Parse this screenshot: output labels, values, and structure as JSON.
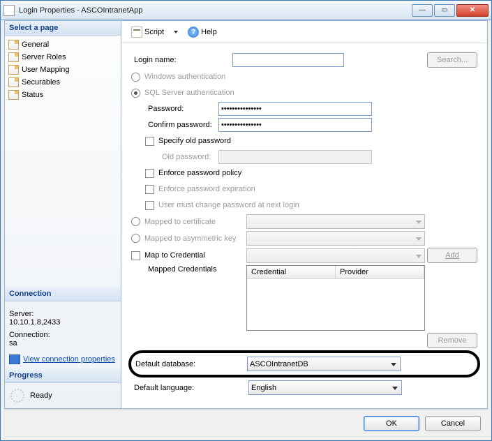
{
  "window": {
    "title": "Login Properties - ASCOIntranetApp"
  },
  "sidebar": {
    "select_page": "Select a page",
    "pages": [
      "General",
      "Server Roles",
      "User Mapping",
      "Securables",
      "Status"
    ],
    "connection_header": "Connection",
    "server_label": "Server:",
    "server_value": "10.10.1.8,2433",
    "connection_label": "Connection:",
    "connection_value": "sa",
    "view_props": "View connection properties",
    "progress_header": "Progress",
    "progress_status": "Ready"
  },
  "toolbar": {
    "script": "Script",
    "help": "Help"
  },
  "form": {
    "login_name_label": "Login name:",
    "login_name_value": "",
    "search_btn": "Search...",
    "windows_auth": "Windows authentication",
    "sql_auth": "SQL Server authentication",
    "password_label": "Password:",
    "password_value": "•••••••••••••••",
    "confirm_label": "Confirm password:",
    "confirm_value": "•••••••••••••••",
    "specify_old": "Specify old password",
    "old_password_label": "Old password:",
    "enforce_policy": "Enforce password policy",
    "enforce_expiration": "Enforce password expiration",
    "must_change": "User must change password at next login",
    "mapped_cert": "Mapped to certificate",
    "mapped_asym": "Mapped to asymmetric key",
    "map_credential": "Map to Credential",
    "add_btn": "Add",
    "mapped_credentials": "Mapped Credentials",
    "col_credential": "Credential",
    "col_provider": "Provider",
    "remove_btn": "Remove",
    "default_db_label": "Default database:",
    "default_db_value": "ASCOIntranetDB",
    "default_lang_label": "Default language:",
    "default_lang_value": "English"
  },
  "footer": {
    "ok": "OK",
    "cancel": "Cancel"
  }
}
